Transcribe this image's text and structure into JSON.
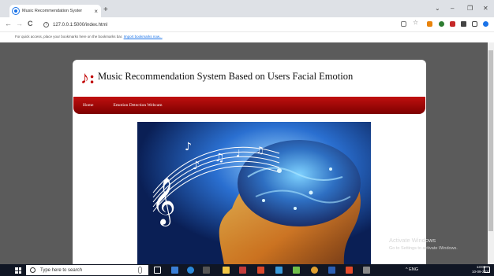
{
  "browser": {
    "tab_title": "Music Recommendation Syster",
    "tab_close": "×",
    "new_tab": "+",
    "window_minimize": "–",
    "window_restore": "❐",
    "window_close": "✕",
    "tab_search": "⌄",
    "back": "←",
    "forward": "→",
    "reload": "C",
    "url": "127.0.0.1:5000/index.html",
    "bookmarks_text": "For quick access, place your bookmarks here on the bookmarks bar.",
    "bookmarks_link": "Import bookmarks now..."
  },
  "page": {
    "logo": "♪:",
    "title": "Music Recommendation System Based on Users Facial Emotion",
    "menu": [
      {
        "label": "Home"
      },
      {
        "label": "Emotion Detection Webcam"
      }
    ]
  },
  "watermark": {
    "line1": "Activate Windows",
    "line2": "Go to Settings to activate Windows."
  },
  "taskbar": {
    "search_placeholder": "Type here to search",
    "time": "13:06",
    "date": "10-09-2022",
    "tray_text": "^ ENG"
  },
  "colors": {
    "menu_red": "#b00000",
    "logo_red": "#c00000",
    "page_bg": "#5b5b5b"
  }
}
